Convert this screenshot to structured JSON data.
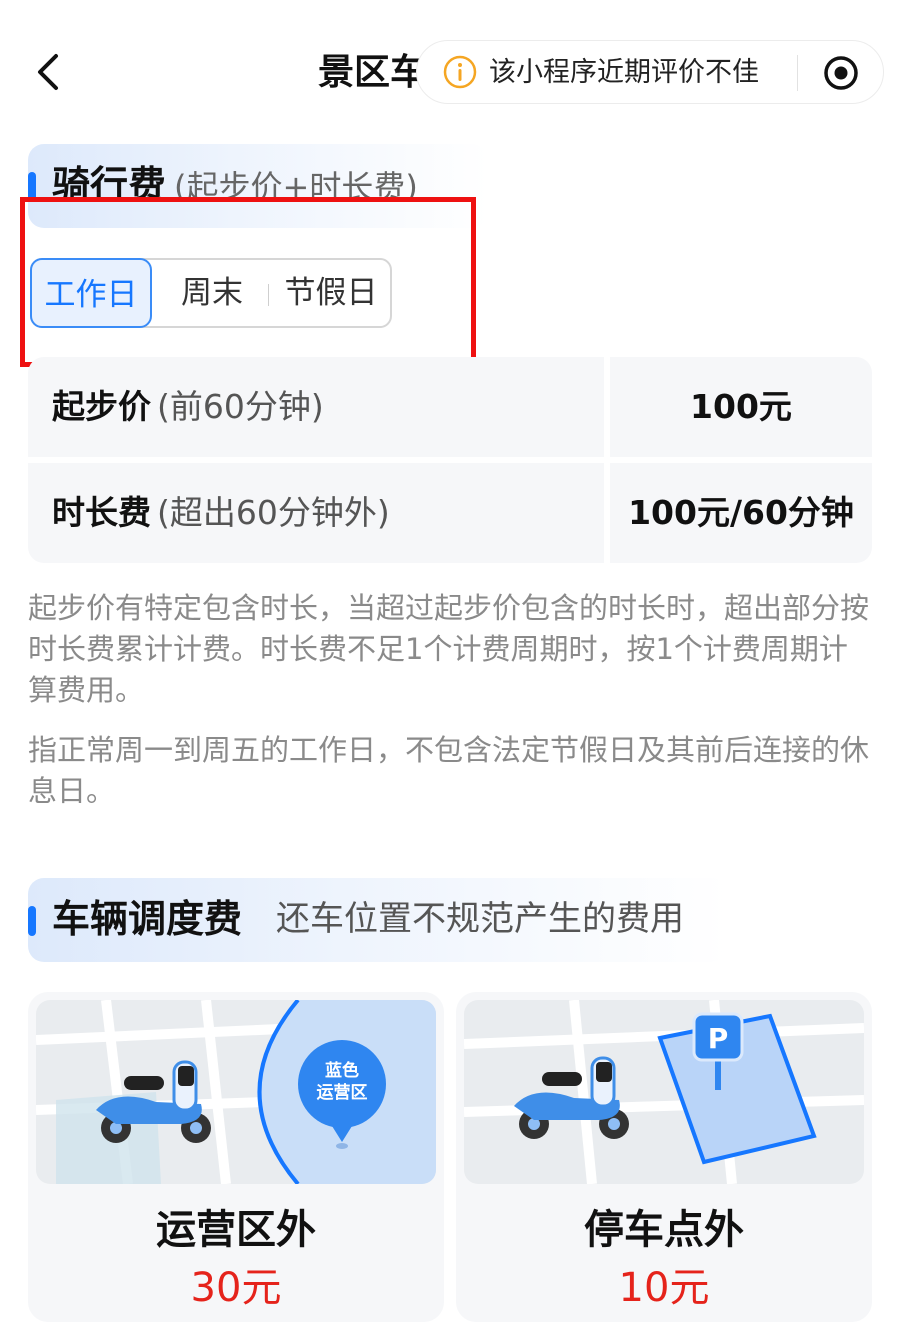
{
  "header": {
    "title": "景区车",
    "warning_text": "该小程序近期评价不佳"
  },
  "riding_fee": {
    "title": "骑行费",
    "subtitle": "(起步价+时长费)",
    "tabs": [
      {
        "label": "工作日",
        "active": true
      },
      {
        "label": "周末",
        "active": false
      },
      {
        "label": "节假日",
        "active": false
      }
    ],
    "rows": [
      {
        "label": "起步价",
        "note": "(前60分钟)",
        "value": "100元"
      },
      {
        "label": "时长费",
        "note": "(超出60分钟外)",
        "value": "100元/60分钟"
      }
    ],
    "note1": "起步价有特定包含时长，当超过起步价包含的时长时，超出部分按时长费累计计费。时长费不足1个计费周期时，按1个计费周期计算费用。",
    "note2": "指正常周一到周五的工作日，不包含法定节假日及其前后连接的休息日。"
  },
  "dispatch_fee": {
    "title": "车辆调度费",
    "subtitle": "还车位置不规范产生的费用",
    "cards": [
      {
        "title": "运营区外",
        "price": "30元",
        "badge_line1": "蓝色",
        "badge_line2": "运营区"
      },
      {
        "title": "停车点外",
        "price": "10元",
        "sign": "P"
      }
    ]
  },
  "colors": {
    "accent": "#1677ff",
    "price_red": "#e5231b",
    "highlight_red": "#ee1111",
    "warning_orange": "#f5a623"
  }
}
